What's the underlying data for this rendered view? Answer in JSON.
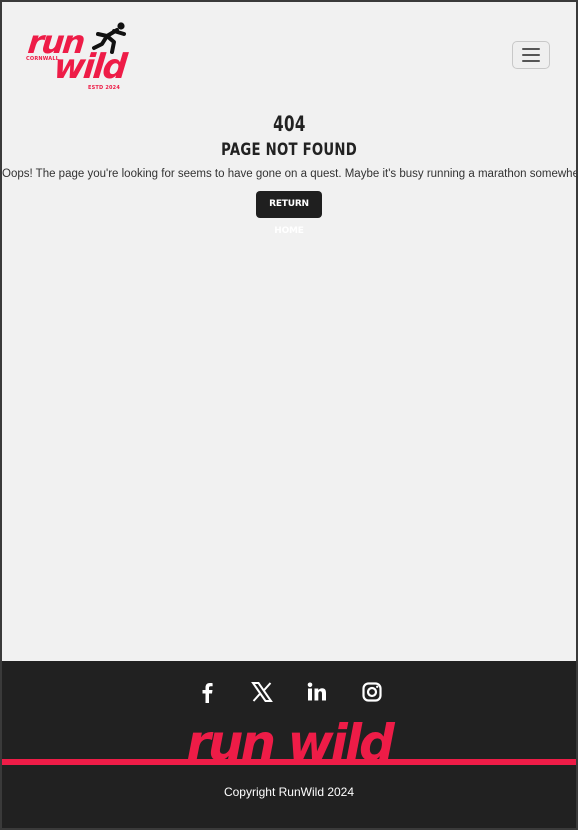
{
  "header": {
    "logo": {
      "line1": "run",
      "line2": "wild",
      "location": "CORNWALL",
      "established": "ESTD 2024"
    },
    "menu_icon": "hamburger-icon"
  },
  "main": {
    "code": "404",
    "heading": "Page Not Found",
    "message": "Oops! The page you're looking for seems to have gone on a quest. Maybe it's busy running a marathon somewhere?",
    "button_label": "Return Home"
  },
  "footer": {
    "socials": [
      {
        "name": "facebook-icon"
      },
      {
        "name": "x-icon"
      },
      {
        "name": "linkedin-icon"
      },
      {
        "name": "instagram-icon"
      }
    ],
    "brand_text": "run wild",
    "copyright": "Copyright RunWild 2024"
  },
  "colors": {
    "brand": "#ee1c47",
    "footer_bg": "#212121",
    "page_bg": "#f1f1f1",
    "button_bg": "#1f1f1f"
  }
}
